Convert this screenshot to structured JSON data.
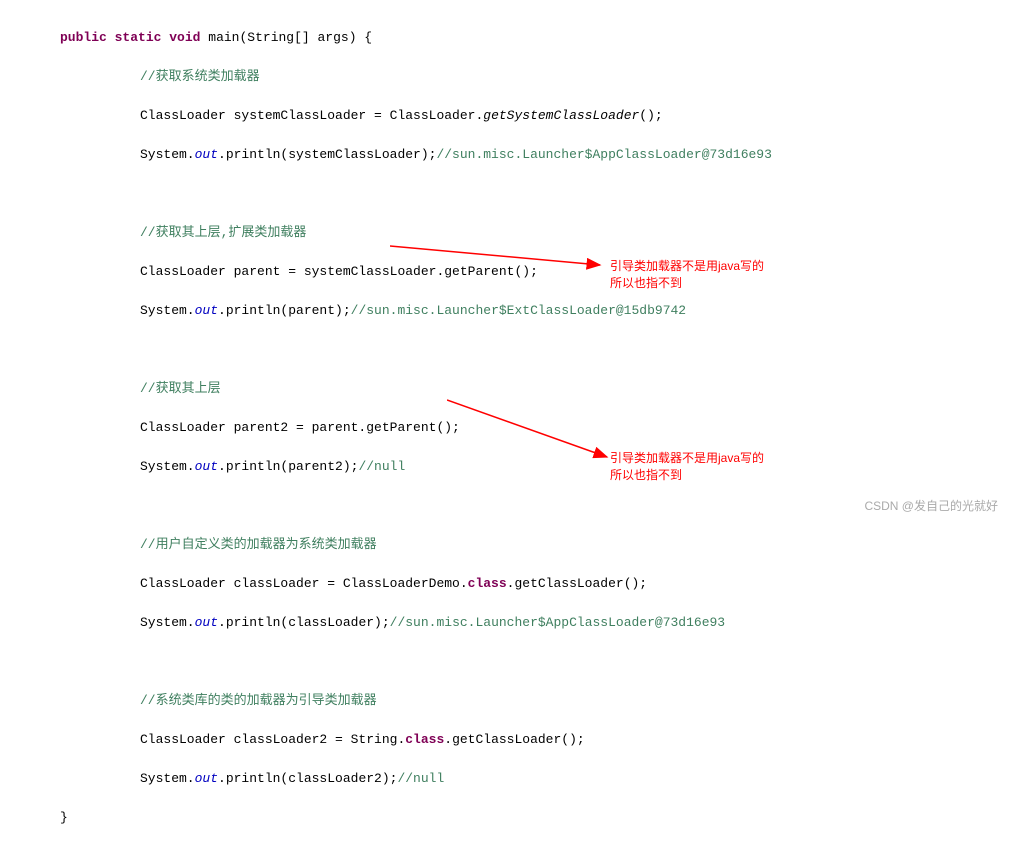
{
  "code": {
    "sig_kw1": "public",
    "sig_kw2": "static",
    "sig_kw3": "void",
    "sig_name": "main(String[] args) {",
    "c1": "//获取系统类加载器",
    "l1a": "ClassLoader systemClassLoader = ClassLoader.",
    "l1b": "getSystemClassLoader",
    "l1c": "();",
    "l2a": "System.",
    "l2b": "out",
    "l2c": ".println(systemClassLoader);",
    "l2d": "//sun.misc.Launcher$AppClassLoader@73d16e93",
    "c2": "//获取其上层,扩展类加载器",
    "l3": "ClassLoader parent = systemClassLoader.getParent();",
    "l4a": "System.",
    "l4b": "out",
    "l4c": ".println(parent);",
    "l4d": "//sun.misc.Launcher$ExtClassLoader@15db9742",
    "c3": "//获取其上层",
    "l5": "ClassLoader parent2 = parent.getParent();",
    "l6a": "System.",
    "l6b": "out",
    "l6c": ".println(parent2);",
    "l6d": "//null",
    "c4": "//用户自定义类的加载器为系统类加载器",
    "l7a": "ClassLoader classLoader = ClassLoaderDemo.",
    "l7b": "class",
    "l7c": ".getClassLoader();",
    "l8a": "System.",
    "l8b": "out",
    "l8c": ".println(classLoader);",
    "l8d": "//sun.misc.Launcher$AppClassLoader@73d16e93",
    "c5": "//系统类库的类的加载器为引导类加载器",
    "l9a": "ClassLoader classLoader2 = String.",
    "l9b": "class",
    "l9c": ".getClassLoader();",
    "l10a": "System.",
    "l10b": "out",
    "l10c": ".println(classLoader2);",
    "l10d": "//null",
    "close": "}"
  },
  "annotations": {
    "a1_line1": "引导类加载器不是用java写的",
    "a1_line2": "所以也指不到",
    "a2_line1": "引导类加载器不是用java写的",
    "a2_line2": "所以也指不到"
  },
  "watermark": "CSDN @发自己的光就好"
}
